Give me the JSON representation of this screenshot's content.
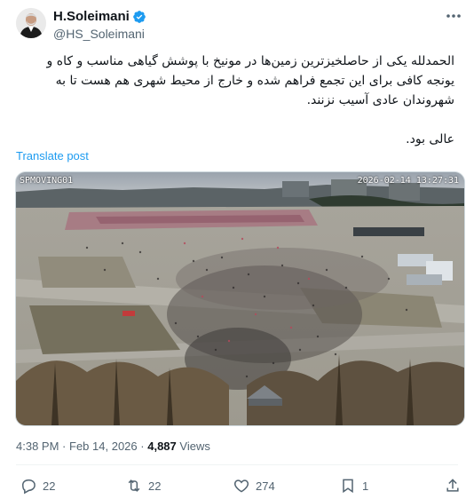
{
  "author": {
    "display_name": "H.Soleimani",
    "handle": "@HS_Soleimani",
    "verified_color": "#1d9bf0"
  },
  "post": {
    "paragraph1": "الحمدلله یکی از حاصلخیزترین زمین‌ها در مونیخ با پوشش گیاهی مناسب و کاه و یونجه کافی برای این تجمع فراهم شده و خارج از محیط شهری هم هست تا به شهروندان عادی آسیب نزنند.",
    "paragraph2": "عالی بود.",
    "translate_label": "Translate post"
  },
  "media": {
    "overlay_left": "SPMOVING01",
    "overlay_right": "2026-02-14 13:27:31"
  },
  "meta": {
    "time": "4:38 PM",
    "separator": "·",
    "date": "Feb 14, 2026",
    "views_count": "4,887",
    "views_label": "Views"
  },
  "actions": {
    "replies": "22",
    "reposts": "22",
    "likes": "274",
    "bookmarks": "1"
  },
  "icons": [
    "verified-badge-icon",
    "more-icon",
    "reply-icon",
    "repost-icon",
    "like-icon",
    "bookmark-icon",
    "share-icon"
  ],
  "colors": {
    "accent": "#1d9bf0",
    "muted": "#536471",
    "text": "#0f1419"
  }
}
